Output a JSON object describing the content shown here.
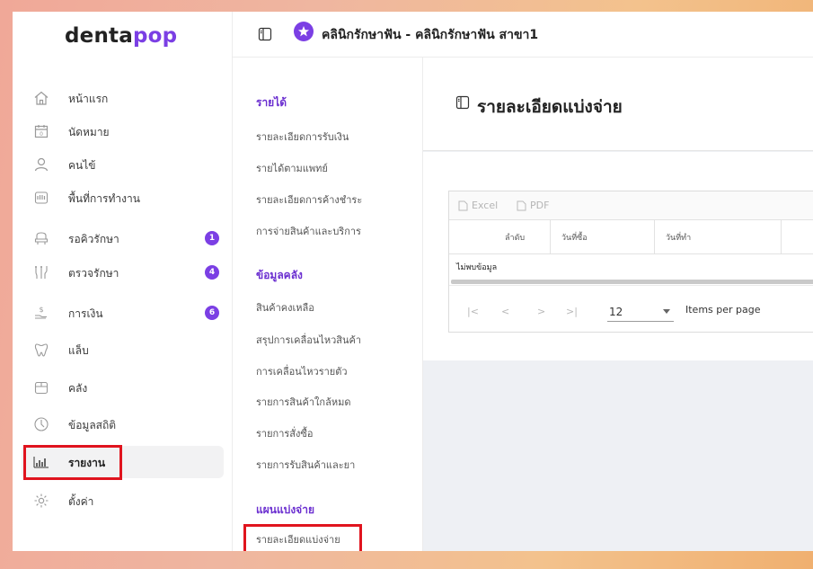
{
  "brand": {
    "part1": "denta",
    "part2": "pop"
  },
  "header": {
    "clinic": "คลินิกรักษาฟัน - คลินิกรักษาฟัน สาขา1"
  },
  "sidebar": {
    "items": [
      {
        "label": "หน้าแรก",
        "icon": "home-icon"
      },
      {
        "label": "นัดหมาย",
        "icon": "calendar-icon"
      },
      {
        "label": "คนไข้",
        "icon": "user-icon"
      },
      {
        "label": "พื้นที่การทำงาน",
        "icon": "teeth-workspace-icon"
      },
      {
        "label": "รอคิวรักษา",
        "icon": "dental-chair-icon",
        "badge": "1"
      },
      {
        "label": "ตรวจรักษา",
        "icon": "dental-tools-icon",
        "badge": "4"
      },
      {
        "label": "การเงิน",
        "icon": "money-hand-icon",
        "badge": "6"
      },
      {
        "label": "แล็บ",
        "icon": "tooth-icon"
      },
      {
        "label": "คลัง",
        "icon": "box-icon"
      },
      {
        "label": "ข้อมูลสถิติ",
        "icon": "statistics-icon"
      },
      {
        "label": "รายงาน",
        "icon": "bar-chart-icon",
        "active": true
      },
      {
        "label": "ตั้งค่า",
        "icon": "gear-icon"
      }
    ]
  },
  "submenu": {
    "sections": [
      {
        "title": "รายได้",
        "links": [
          "รายละเอียดการรับเงิน",
          "รายได้ตามแพทย์",
          "รายละเอียดการค้างชำระ",
          "การจ่ายสินค้าและบริการ"
        ]
      },
      {
        "title": "ข้อมูลคลัง",
        "links": [
          "สินค้าคงเหลือ",
          "สรุปการเคลื่อนไหวสินค้า",
          "การเคลื่อนไหวรายตัว",
          "รายการสินค้าใกล้หมด",
          "รายการสั่งซื้อ",
          "รายการรับสินค้าและยา"
        ]
      },
      {
        "title": "แผนแบ่งจ่าย",
        "links": [
          "รายละเอียดแบ่งจ่าย"
        ]
      }
    ]
  },
  "main": {
    "title": "รายละเอียดแบ่งจ่าย",
    "toolbar": {
      "excel": "Excel",
      "pdf": "PDF"
    },
    "columns": [
      "ลำดับ",
      "วันที่ซื้อ",
      "วันที่ทำ"
    ],
    "empty": "ไม่พบข้อมูล",
    "pager": {
      "first": "|<",
      "prev": "<",
      "next": ">",
      "last": ">|",
      "page_size": "12",
      "label": "Items per page"
    }
  },
  "colors": {
    "accent": "#7b3fe4",
    "highlight": "#e0141e"
  }
}
